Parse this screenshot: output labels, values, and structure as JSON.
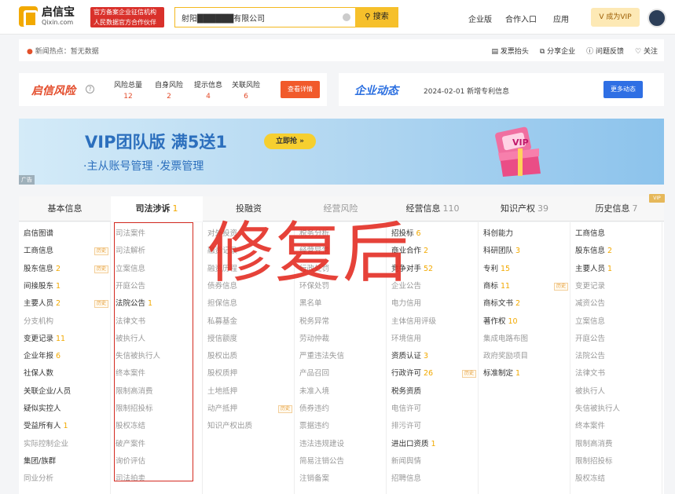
{
  "header": {
    "logo_cn": "启信宝",
    "logo_en": "Qixin.com",
    "badge_line1": "官方备案企业征信机构",
    "badge_line2": "人民数据官方合作伙伴",
    "search_value": "射阳██████有限公司",
    "search_button": "搜索",
    "nav": [
      "企业版",
      "合作入口",
      "应用"
    ],
    "vip_button": "成为VIP"
  },
  "news": {
    "label": "新闻热点：暂无数据",
    "actions": [
      "发票抬头",
      "分享企业",
      "问题反馈",
      "关注"
    ]
  },
  "risk": {
    "brand": "启信风险",
    "items": [
      {
        "label": "风险总量",
        "value": "12"
      },
      {
        "label": "自身风险",
        "value": "2"
      },
      {
        "label": "提示信息",
        "value": "4"
      },
      {
        "label": "关联风险",
        "value": "6"
      }
    ],
    "button": "查看详情"
  },
  "dynamics": {
    "brand": "企业动态",
    "text": "2024-02-01 新增专利信息",
    "button": "更多动态"
  },
  "banner": {
    "title": "VIP团队版 满5送1",
    "cta": "立即抢",
    "subtitle": "·主从账号管理 ·发票管理",
    "tag": "广告",
    "gift_label": "VIP"
  },
  "tabs": [
    {
      "label": "基本信息",
      "count": ""
    },
    {
      "label": "司法涉诉",
      "count": "1"
    },
    {
      "label": "投融资",
      "count": ""
    },
    {
      "label": "经营风险",
      "count": ""
    },
    {
      "label": "经营信息",
      "count": "110"
    },
    {
      "label": "知识产权",
      "count": "39"
    },
    {
      "label": "历史信息",
      "count": "7"
    }
  ],
  "vip_corner": "VIP",
  "columns": [
    [
      {
        "t": "启信图谱"
      },
      {
        "t": "工商信息",
        "h": "历史"
      },
      {
        "t": "股东信息",
        "n": "2",
        "h": "历史"
      },
      {
        "t": "间接股东",
        "n": "1"
      },
      {
        "t": "主要人员",
        "n": "2",
        "h": "历史"
      },
      {
        "t": "分支机构",
        "d": true
      },
      {
        "t": "变更记录",
        "n": "11"
      },
      {
        "t": "企业年报",
        "n": "6"
      },
      {
        "t": "社保人数"
      },
      {
        "t": "关联企业/人员"
      },
      {
        "t": "疑似实控人"
      },
      {
        "t": "受益所有人",
        "n": "1"
      },
      {
        "t": "实际控制企业",
        "d": true
      },
      {
        "t": "集团/族群"
      },
      {
        "t": "同业分析",
        "d": true
      }
    ],
    [
      {
        "t": "司法案件",
        "d": true
      },
      {
        "t": "司法解析",
        "d": true
      },
      {
        "t": "立案信息",
        "d": true
      },
      {
        "t": "开庭公告",
        "d": true
      },
      {
        "t": "法院公告",
        "n": "1"
      },
      {
        "t": "法律文书",
        "d": true
      },
      {
        "t": "被执行人",
        "d": true
      },
      {
        "t": "失信被执行人",
        "d": true
      },
      {
        "t": "终本案件",
        "d": true
      },
      {
        "t": "限制高消费",
        "d": true
      },
      {
        "t": "限制招投标",
        "d": true
      },
      {
        "t": "股权冻结",
        "d": true
      },
      {
        "t": "破产案件",
        "d": true
      },
      {
        "t": "询价评估",
        "d": true
      },
      {
        "t": "司法拍卖",
        "d": true
      }
    ],
    [
      {
        "t": "对外投资",
        "d": true
      },
      {
        "t": "融资记录",
        "d": true
      },
      {
        "t": "融资历程",
        "d": true
      },
      {
        "t": "债券信息",
        "d": true
      },
      {
        "t": "担保信息",
        "d": true
      },
      {
        "t": "私募基金",
        "d": true
      },
      {
        "t": "授信额度",
        "d": true
      },
      {
        "t": "股权出质",
        "d": true
      },
      {
        "t": "股权质押",
        "d": true
      },
      {
        "t": "土地抵押",
        "d": true
      },
      {
        "t": "动产抵押",
        "d": true,
        "h": "历史"
      },
      {
        "t": "知识产权出质",
        "d": true
      }
    ],
    [
      {
        "t": "税务分析",
        "d": true
      },
      {
        "t": "经营异常",
        "d": true
      },
      {
        "t": "行政处罚",
        "d": true
      },
      {
        "t": "环保处罚",
        "d": true
      },
      {
        "t": "黑名单",
        "d": true
      },
      {
        "t": "税务异常",
        "d": true
      },
      {
        "t": "劳动仲裁",
        "d": true
      },
      {
        "t": "严重违法失信",
        "d": true
      },
      {
        "t": "产品召回",
        "d": true
      },
      {
        "t": "未准入境",
        "d": true
      },
      {
        "t": "债券违约",
        "d": true
      },
      {
        "t": "票据违约",
        "d": true
      },
      {
        "t": "违法违规建设",
        "d": true
      },
      {
        "t": "简易注销公告",
        "d": true
      },
      {
        "t": "注销备案",
        "d": true
      }
    ],
    [
      {
        "t": "招投标",
        "n": "6"
      },
      {
        "t": "商业合作",
        "n": "2"
      },
      {
        "t": "竞争对手",
        "n": "52"
      },
      {
        "t": "企业公告",
        "d": true
      },
      {
        "t": "电力信用",
        "d": true
      },
      {
        "t": "主体信用评级",
        "d": true
      },
      {
        "t": "环境信用",
        "d": true
      },
      {
        "t": "资质认证",
        "n": "3"
      },
      {
        "t": "行政许可",
        "n": "26",
        "h": "历史"
      },
      {
        "t": "税务资质"
      },
      {
        "t": "电信许可",
        "d": true
      },
      {
        "t": "排污许可",
        "d": true
      },
      {
        "t": "进出口资质",
        "n": "1"
      },
      {
        "t": "新闻舆情",
        "d": true
      },
      {
        "t": "招聘信息",
        "d": true
      }
    ],
    [
      {
        "t": "科创能力"
      },
      {
        "t": "科研团队",
        "n": "3"
      },
      {
        "t": "专利",
        "n": "15"
      },
      {
        "t": "商标",
        "n": "11",
        "h": "历史"
      },
      {
        "t": "商标文书",
        "n": "2"
      },
      {
        "t": "著作权",
        "n": "10"
      },
      {
        "t": "集成电路布图",
        "d": true
      },
      {
        "t": "政府奖励项目",
        "d": true
      },
      {
        "t": "标准制定",
        "n": "1"
      }
    ],
    [
      {
        "t": "工商信息"
      },
      {
        "t": "股东信息",
        "n": "2"
      },
      {
        "t": "主要人员",
        "n": "1"
      },
      {
        "t": "变更记录",
        "d": true
      },
      {
        "t": "减资公告",
        "d": true
      },
      {
        "t": "立案信息",
        "d": true
      },
      {
        "t": "开庭公告",
        "d": true
      },
      {
        "t": "法院公告",
        "d": true
      },
      {
        "t": "法律文书",
        "d": true
      },
      {
        "t": "被执行人",
        "d": true
      },
      {
        "t": "失信被执行人",
        "d": true
      },
      {
        "t": "终本案件",
        "d": true
      },
      {
        "t": "限制高消费",
        "d": true
      },
      {
        "t": "限制招投标",
        "d": true
      },
      {
        "t": "股权冻结",
        "d": true
      }
    ]
  ],
  "overlay_text": "修复后"
}
